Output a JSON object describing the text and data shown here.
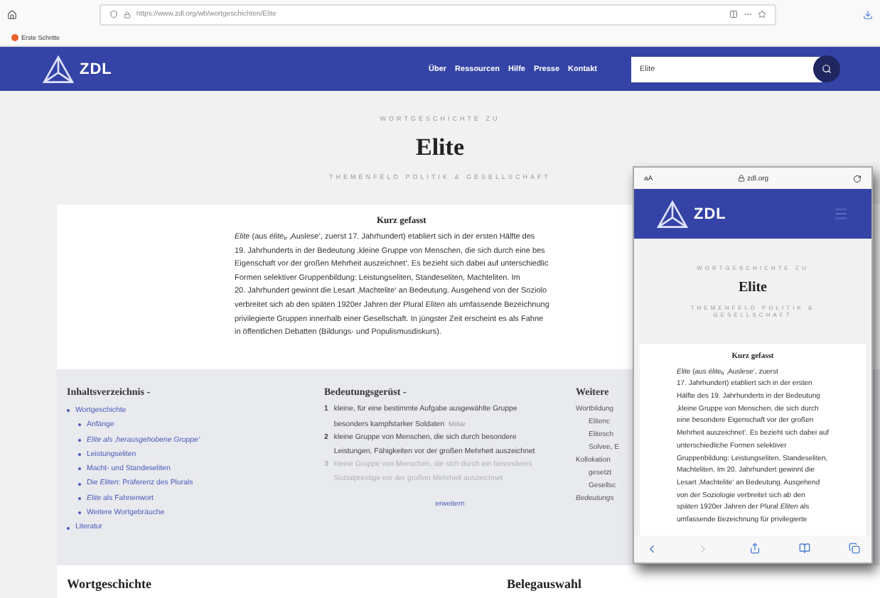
{
  "browser": {
    "url": "https://www.zdl.org/wb/wortgeschichten/Elite",
    "bookmarks": [
      "Erste Schritte"
    ]
  },
  "site_nav": {
    "logo": "ZDL",
    "links": [
      "Über",
      "Ressourcen",
      "Hilfe",
      "Presse",
      "Kontakt"
    ],
    "search": {
      "value": "Elite"
    }
  },
  "article_header": {
    "kicker": "WORTGESCHICHTE ZU",
    "title": "Elite",
    "topic": "THEMENFELD POLITIK & GESELLSCHAFT"
  },
  "summary": {
    "heading": "Kurz gefasst",
    "lines": [
      "*Elite* (aus *élite*$_{fr}$ ‚Auslese‘, zuerst 17. Jahrhundert) etabliert sich in der ersten Hälfte des",
      "19. Jahrhunderts in der Bedeutung ‚kleine Gruppe von Menschen, die sich durch eine bes",
      "Eigenschaft vor der großen Mehrheit auszeichnet‘. Es bezieht sich dabei auf unterschiedlic",
      "Formen selektiver Gruppenbildung: Leistungseliten, Standeseliten, Machteliten. Im",
      "20. Jahrhundert gewinnt die Lesart ‚Machtelite‘ an Bedeutung. Ausgehend von der Soziolo",
      "verbreitet sich ab den späten 1920er Jahren der Plural *Eliten* als umfassende Bezeichnung",
      "privilegierte Gruppen innerhalb einer Gesellschaft. In jüngster Zeit erscheint es als Fahne",
      "in öffentlichen Debatten (Bildungs- und Populismusdiskurs)."
    ]
  },
  "toc": {
    "heading": "Inhaltsverzeichnis",
    "toggle": "-",
    "items": [
      {
        "label": "Wortgeschichte",
        "children": [
          {
            "label": "Anfänge"
          },
          {
            "label": "*Elite als ‚herausgehobene Gruppe‘*"
          },
          {
            "label": "Leistungseliten"
          },
          {
            "label": "Macht- und Standeseliten"
          },
          {
            "label": "Die *Eliten*: Präferenz des Plurals"
          },
          {
            "label": "*Elite* als Fahnenwort"
          },
          {
            "label": "Weitere Wortgebräuche"
          }
        ]
      },
      {
        "label": "Literatur"
      }
    ]
  },
  "meanings": {
    "heading": "Bedeutungsgerüst",
    "toggle": "-",
    "items": [
      {
        "number": "1",
        "text": "kleine, für eine bestimmte Aufgabe ausgewählte Gruppe besonders kampfstarker Soldaten",
        "tag": "Militär",
        "faded": false
      },
      {
        "number": "2",
        "text": "kleine Gruppe von Menschen, die sich durch besondere Leistungen, Fähigkeiten vor der großen Mehrheit auszeichnet",
        "faded": false
      },
      {
        "number": "3",
        "text": "kleine Gruppe von Menschen, die sich durch ein besonderes Sozialprestige vor der großen Mehrheit auszeichnet",
        "faded": true
      }
    ],
    "more_link": "erweitern"
  },
  "further": {
    "heading": "Weitere",
    "items": [
      {
        "label": "Wortbildung",
        "children": [
          "Elitenc",
          "Elitesch",
          "Solvee, E"
        ]
      },
      {
        "label": "Kollokation",
        "children": [
          "gesetzt",
          "Gesellsc"
        ]
      },
      {
        "label": "*Bedeutungs*"
      }
    ]
  },
  "sections": [
    "Wortgeschichte",
    "Belegauswahl"
  ],
  "phone": {
    "text_size": "aA",
    "domain": "zdl.org",
    "logo": "ZDL",
    "kicker": "WORTGESCHICHTE ZU",
    "title": "Elite",
    "topic": "THEMENFELD POLITIK & GESELLSCHAFT",
    "summary_heading": "Kurz gefasst",
    "summary_lines": [
      "*Elite* (aus *élite*$_{fr}$ ‚Auslese‘, zuerst",
      "17. Jahrhundert) etabliert sich in der ersten",
      "Hälfte des 19. Jahrhunderts in der Bedeutung",
      "‚kleine Gruppe von Menschen, die sich durch",
      "eine besondere Eigenschaft vor der großen",
      "Mehrheit auszeichnet‘. Es bezieht sich dabei auf",
      "unterschiedliche Formen selektiver",
      "Gruppenbildung: Leistungseliten, Standeseliten,",
      "Machteliten. Im 20. Jahrhundert gewinnt die",
      "Lesart ‚Machtelite‘ an Bedeutung. Ausgehend",
      "von der Soziologie verbreitet sich ab den",
      "späten 1920er Jahren der Plural *Eliten* als",
      "umfassende Bezeichnung für privilegierte"
    ],
    "forward_disabled": true
  }
}
